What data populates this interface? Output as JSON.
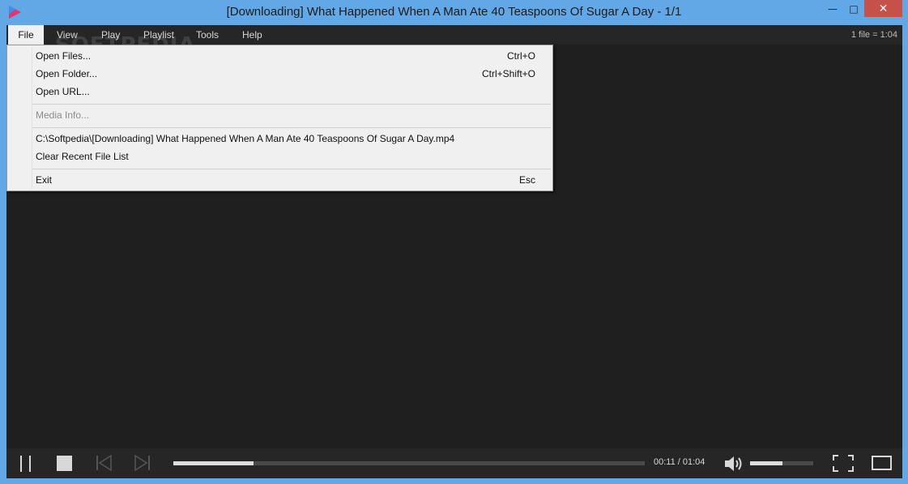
{
  "window": {
    "title": "[Downloading] What Happened When A Man Ate 40 Teaspoons Of Sugar A Day - 1/1",
    "minimize_glyph": "—",
    "maximize_glyph": "□",
    "close_glyph": "✕"
  },
  "menubar": {
    "items": [
      "File",
      "View",
      "Play",
      "Playlist",
      "Tools",
      "Help"
    ],
    "file_count": "1 file = 1:04"
  },
  "watermark": "SOFTPEDIA",
  "file_menu": {
    "items": [
      {
        "label": "Open Files...",
        "shortcut": "Ctrl+O"
      },
      {
        "label": "Open Folder...",
        "shortcut": "Ctrl+Shift+O"
      },
      {
        "label": "Open URL...",
        "shortcut": ""
      },
      {
        "label": "Media Info...",
        "shortcut": "",
        "disabled": true
      },
      {
        "label": "C:\\Softpedia\\[Downloading] What Happened When A Man Ate 40 Teaspoons Of Sugar A Day.mp4",
        "shortcut": ""
      },
      {
        "label": "Clear Recent File List",
        "shortcut": ""
      },
      {
        "label": "Exit",
        "shortcut": "Esc"
      }
    ]
  },
  "controls": {
    "time": "00:11 / 01:04",
    "seek_progress": 0.17,
    "volume_level": 0.51
  },
  "colors": {
    "accent": "#62a8e6",
    "background": "#1f1f1f",
    "bars": "#262626",
    "close": "#c7504b"
  }
}
